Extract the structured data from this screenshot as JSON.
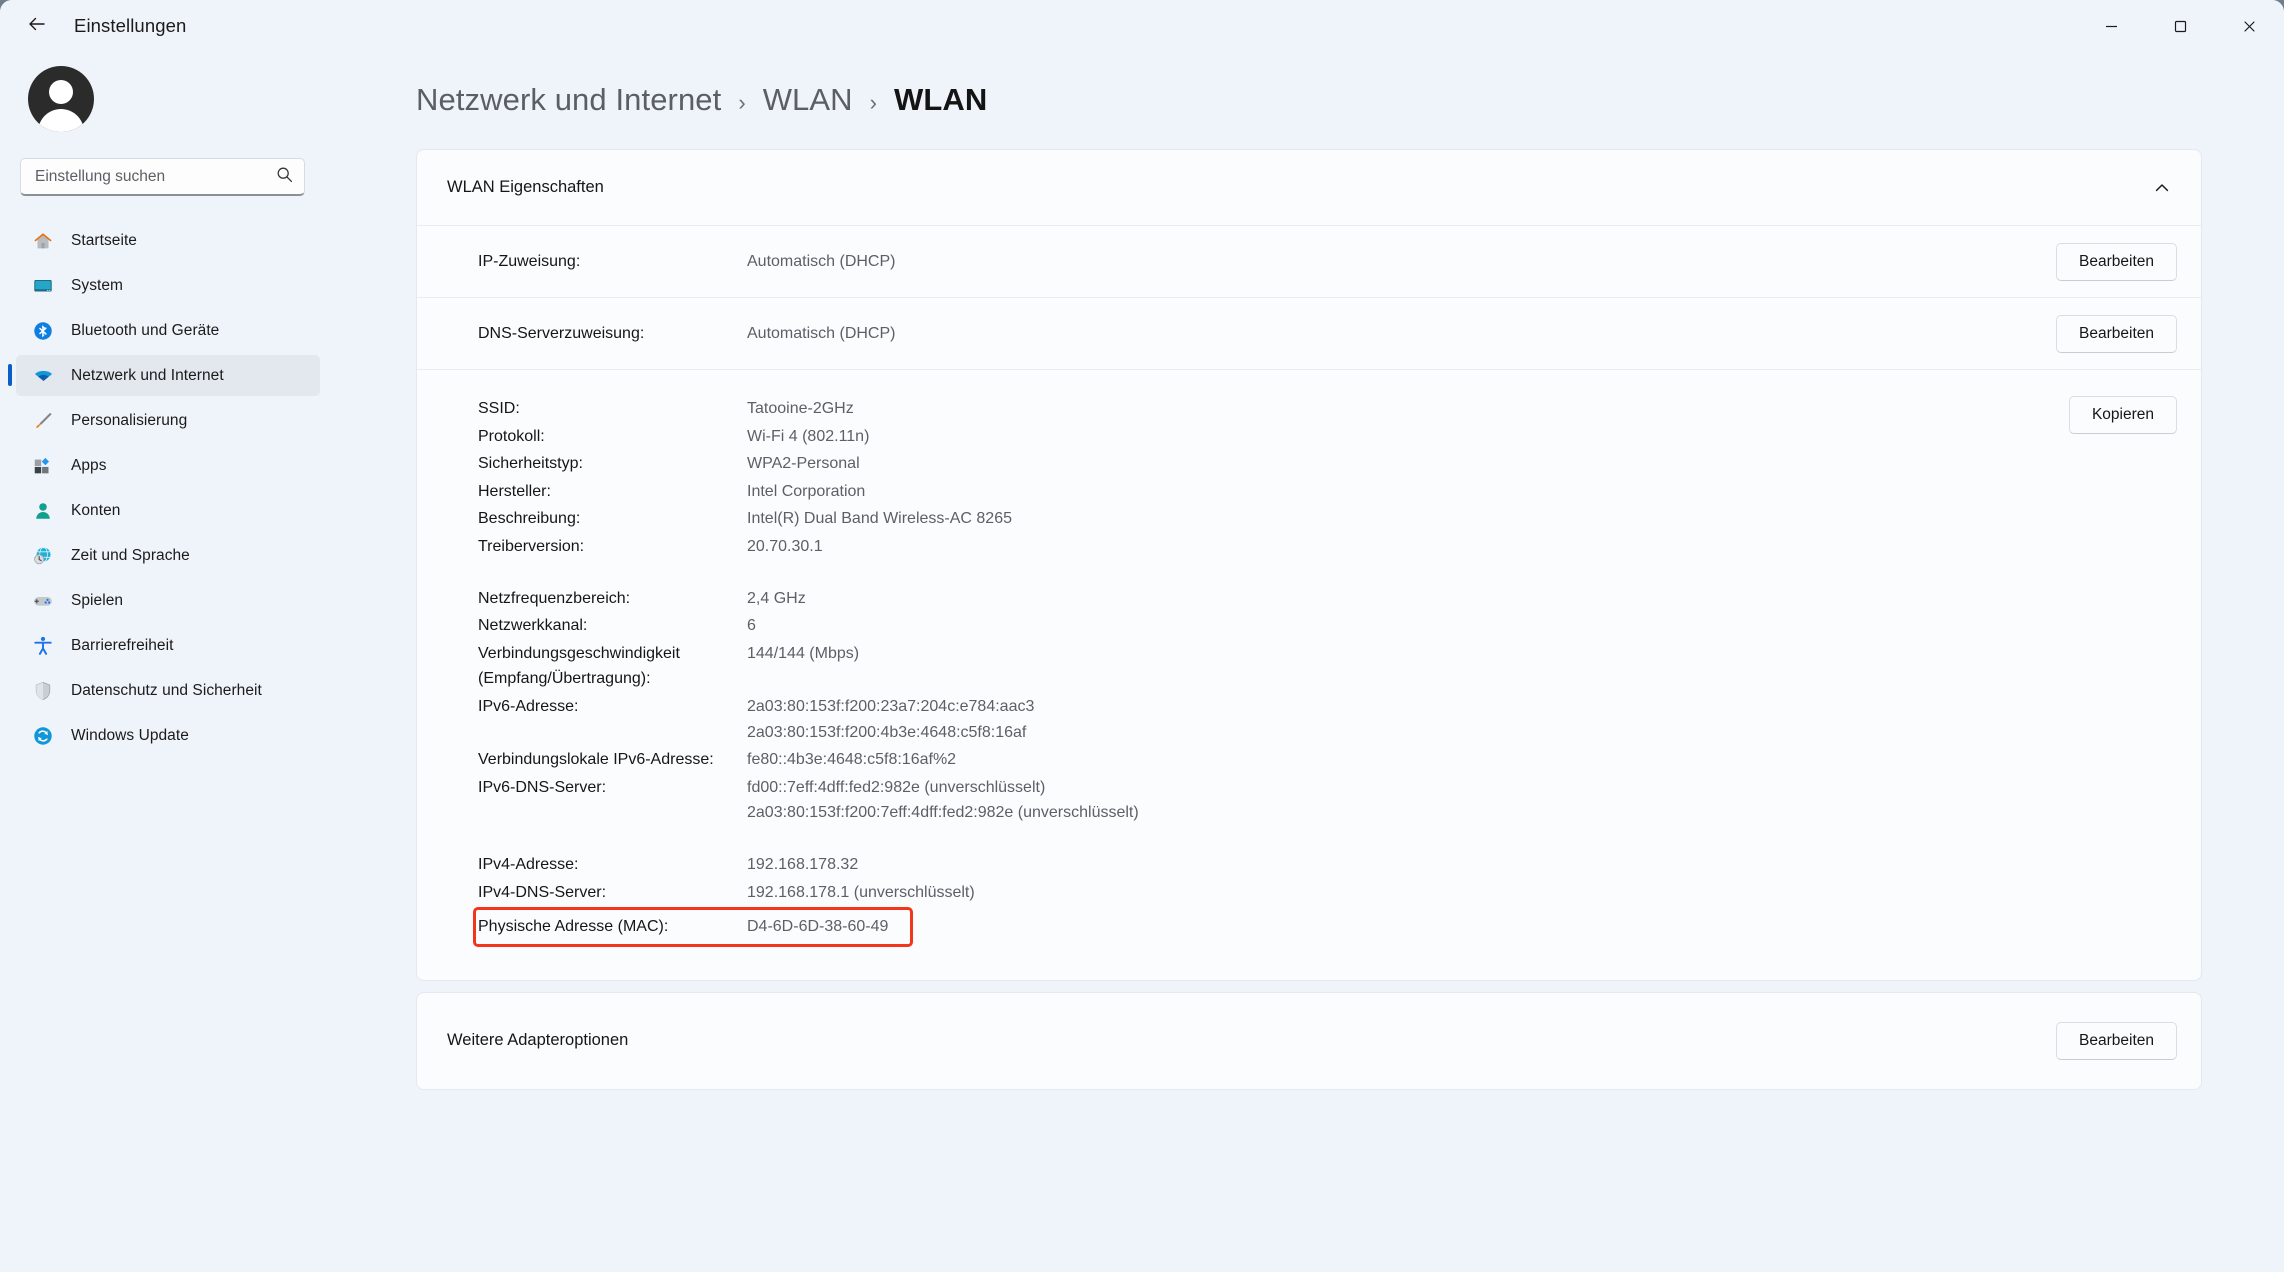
{
  "window": {
    "title": "Einstellungen",
    "back_icon": "arrow-left-icon",
    "controls": {
      "minimize": "minimize-icon",
      "maximize": "maximize-icon",
      "close": "close-icon"
    }
  },
  "sidebar": {
    "avatar": "user-avatar",
    "search": {
      "placeholder": "Einstellung suchen",
      "value": "",
      "icon": "search-icon"
    },
    "items": [
      {
        "label": "Startseite",
        "icon": "home-icon",
        "selected": false
      },
      {
        "label": "System",
        "icon": "monitor-icon",
        "selected": false
      },
      {
        "label": "Bluetooth und Geräte",
        "icon": "bluetooth-icon",
        "selected": false
      },
      {
        "label": "Netzwerk und Internet",
        "icon": "wifi-icon",
        "selected": true
      },
      {
        "label": "Personalisierung",
        "icon": "paintbrush-icon",
        "selected": false
      },
      {
        "label": "Apps",
        "icon": "apps-icon",
        "selected": false
      },
      {
        "label": "Konten",
        "icon": "account-icon",
        "selected": false
      },
      {
        "label": "Zeit und Sprache",
        "icon": "globe-clock-icon",
        "selected": false
      },
      {
        "label": "Spielen",
        "icon": "gamepad-icon",
        "selected": false
      },
      {
        "label": "Barrierefreiheit",
        "icon": "accessibility-icon",
        "selected": false
      },
      {
        "label": "Datenschutz und Sicherheit",
        "icon": "shield-icon",
        "selected": false
      },
      {
        "label": "Windows Update",
        "icon": "update-icon",
        "selected": false
      }
    ]
  },
  "breadcrumb": {
    "root": "Netzwerk und Internet",
    "separator": "›",
    "mid": "WLAN",
    "current": "WLAN"
  },
  "properties_card": {
    "title": "WLAN Eigenschaften",
    "collapse_icon": "chevron-up-icon",
    "rows": [
      {
        "label": "IP-Zuweisung:",
        "value": "Automatisch (DHCP)",
        "button": "Bearbeiten"
      },
      {
        "label": "DNS-Serverzuweisung:",
        "value": "Automatisch (DHCP)",
        "button": "Bearbeiten"
      }
    ],
    "copy_button": "Kopieren",
    "details": [
      {
        "label": "SSID:",
        "value": "Tatooine-2GHz"
      },
      {
        "label": "Protokoll:",
        "value": "Wi-Fi 4 (802.11n)"
      },
      {
        "label": "Sicherheitstyp:",
        "value": "WPA2-Personal"
      },
      {
        "label": "Hersteller:",
        "value": "Intel Corporation"
      },
      {
        "label": "Beschreibung:",
        "value": "Intel(R) Dual Band Wireless-AC 8265"
      },
      {
        "label": "Treiberversion:",
        "value": "20.70.30.1"
      },
      {
        "label": "Netzfrequenzbereich:",
        "value": "2,4 GHz"
      },
      {
        "label": "Netzwerkkanal:",
        "value": "6"
      },
      {
        "label": "Verbindungsgeschwindigkeit (Empfang/Übertragung):",
        "value": "144/144 (Mbps)"
      },
      {
        "label": "IPv6-Adresse:",
        "value": "2a03:80:153f:f200:23a7:204c:e784:aac3\n2a03:80:153f:f200:4b3e:4648:c5f8:16af"
      },
      {
        "label": "Verbindungslokale IPv6-Adresse:",
        "value": "fe80::4b3e:4648:c5f8:16af%2"
      },
      {
        "label": "IPv6-DNS-Server:",
        "value": "fd00::7eff:4dff:fed2:982e (unverschlüsselt)\n2a03:80:153f:f200:7eff:4dff:fed2:982e (unverschlüsselt)"
      },
      {
        "label": "IPv4-Adresse:",
        "value": "192.168.178.32"
      },
      {
        "label": "IPv4-DNS-Server:",
        "value": "192.168.178.1 (unverschlüsselt)"
      },
      {
        "label": "Physische Adresse (MAC):",
        "value": "D4-6D-6D-38-60-49"
      }
    ],
    "highlight_index": 14,
    "highlight_color": "#f2351b"
  },
  "adapter_card": {
    "label": "Weitere Adapteroptionen",
    "button": "Bearbeiten"
  },
  "colors": {
    "accent": "#0a5fc7",
    "page_bg": "#eff3fa",
    "card_bg": "#fbfcfe",
    "highlight": "#f2351b"
  }
}
